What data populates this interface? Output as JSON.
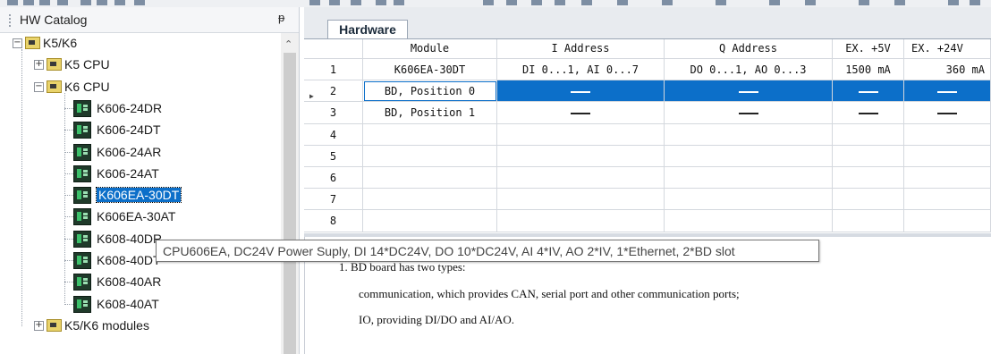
{
  "catalog": {
    "title": "HW Catalog",
    "pin_icon": "pin-icon",
    "tree": [
      {
        "label": "K5/K6",
        "type": "folder",
        "expanded": true,
        "level": 0
      },
      {
        "label": "K5 CPU",
        "type": "folder",
        "expanded": false,
        "level": 1
      },
      {
        "label": "K6 CPU",
        "type": "folder",
        "expanded": true,
        "level": 1
      },
      {
        "label": "K606-24DR",
        "type": "cpu",
        "level": 2
      },
      {
        "label": "K606-24DT",
        "type": "cpu",
        "level": 2
      },
      {
        "label": "K606-24AR",
        "type": "cpu",
        "level": 2
      },
      {
        "label": "K606-24AT",
        "type": "cpu",
        "level": 2
      },
      {
        "label": "K606EA-30DT",
        "type": "cpu",
        "level": 2,
        "selected": true
      },
      {
        "label": "K606EA-30AT",
        "type": "cpu",
        "level": 2
      },
      {
        "label": "K608-40DR",
        "type": "cpu",
        "level": 2
      },
      {
        "label": "K608-40DT",
        "type": "cpu",
        "level": 2
      },
      {
        "label": "K608-40AR",
        "type": "cpu",
        "level": 2
      },
      {
        "label": "K608-40AT",
        "type": "cpu",
        "level": 2
      },
      {
        "label": "K5/K6 modules",
        "type": "folder",
        "expanded": false,
        "level": 1
      }
    ]
  },
  "hardware": {
    "tab_label": "Hardware",
    "columns": [
      "Module",
      "I Address",
      "Q Address",
      "EX. +5V",
      "EX. +24V"
    ],
    "rows": [
      {
        "num": "1",
        "module": "K606EA-30DT",
        "i_addr": "DI 0...1, AI 0...7",
        "q_addr": "DO 0...1, AO 0...3",
        "ex5v": "1500 mA",
        "ex24v": "360 mA"
      },
      {
        "num": "2",
        "module": "BD, Position 0",
        "i_addr": "",
        "q_addr": "",
        "ex5v": "",
        "ex24v": "",
        "selected": true,
        "dashes": true
      },
      {
        "num": "3",
        "module": "BD, Position 1",
        "i_addr": "",
        "q_addr": "",
        "ex5v": "",
        "ex24v": "",
        "dashes": true
      },
      {
        "num": "4",
        "module": "",
        "i_addr": "",
        "q_addr": "",
        "ex5v": "",
        "ex24v": ""
      },
      {
        "num": "5",
        "module": "",
        "i_addr": "",
        "q_addr": "",
        "ex5v": "",
        "ex24v": ""
      },
      {
        "num": "6",
        "module": "",
        "i_addr": "",
        "q_addr": "",
        "ex5v": "",
        "ex24v": ""
      },
      {
        "num": "7",
        "module": "",
        "i_addr": "",
        "q_addr": "",
        "ex5v": "",
        "ex24v": ""
      },
      {
        "num": "8",
        "module": "",
        "i_addr": "",
        "q_addr": "",
        "ex5v": "",
        "ex24v": ""
      }
    ]
  },
  "description": {
    "line1": "1. BD board has two types:",
    "line2": "communication, which provides CAN, serial port and other communication ports;",
    "line3": "IO, providing DI/DO and AI/AO."
  },
  "tooltip": {
    "text": "CPU606EA, DC24V Power Suply, DI 14*DC24V, DO 10*DC24V, AI 4*IV, AO 2*IV, 1*Ethernet, 2*BD slot"
  },
  "colors": {
    "selection": "#0c6fc9",
    "folder": "#e9d36b",
    "module_icon": "#1f3a2a"
  }
}
